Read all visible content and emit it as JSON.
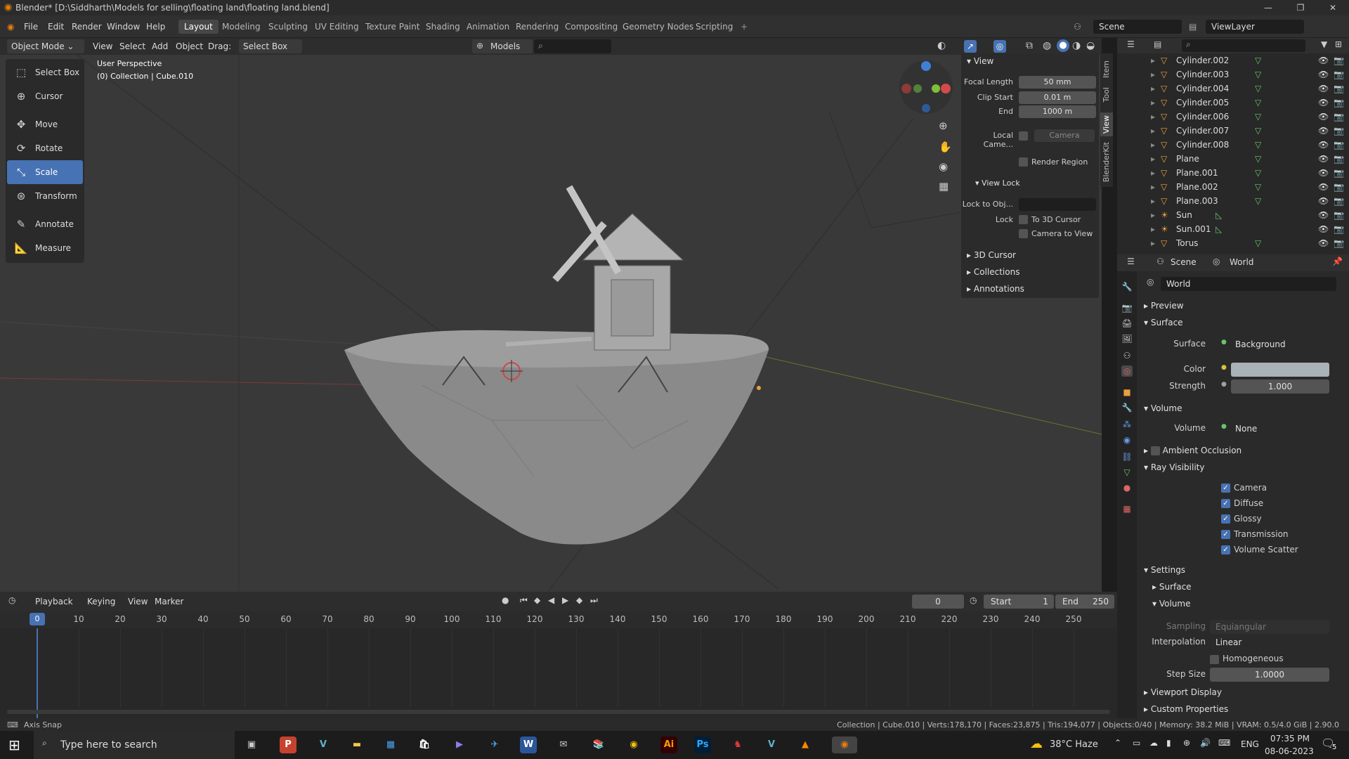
{
  "window": {
    "title": "Blender* [D:\\Siddharth\\Models for selling\\floating land\\floating land.blend]",
    "minimize": "—",
    "maximize": "❐",
    "close": "✕"
  },
  "menu": {
    "file": "File",
    "edit": "Edit",
    "render": "Render",
    "window": "Window",
    "help": "Help"
  },
  "workspaces": [
    "Layout",
    "Modeling",
    "Sculpting",
    "UV Editing",
    "Texture Paint",
    "Shading",
    "Animation",
    "Rendering",
    "Compositing",
    "Geometry Nodes",
    "Scripting"
  ],
  "active_workspace": "Layout",
  "scene_name": "Scene",
  "viewlayer_name": "ViewLayer",
  "viewport_header": {
    "mode": "Object Mode",
    "view": "View",
    "select": "Select",
    "add": "Add",
    "object": "Object",
    "drag_label": "Drag:",
    "drag_value": "Select Box",
    "models": "Models"
  },
  "viewport_info": {
    "line1": "User Perspective",
    "line2": "(0) Collection | Cube.010"
  },
  "tools": [
    "Select Box",
    "Cursor",
    "Move",
    "Rotate",
    "Scale",
    "Transform",
    "Annotate",
    "Measure"
  ],
  "active_tool": "Scale",
  "npanel": {
    "view_header": "View",
    "focal_length_label": "Focal Length",
    "focal_length": "50 mm",
    "clip_start_label": "Clip Start",
    "clip_start": "0.01 m",
    "end_label": "End",
    "end": "1000 m",
    "local_camera_label": "Local Came...",
    "local_camera": "Camera",
    "render_region": "Render Region",
    "view_lock_header": "View Lock",
    "lock_to_obj_label": "Lock to Obj...",
    "lock_label": "Lock",
    "to_3d_cursor": "To 3D Cursor",
    "camera_to_view": "Camera to View",
    "cursor_3d": "3D Cursor",
    "collections": "Collections",
    "annotations": "Annotations",
    "tabs": [
      "Item",
      "Tool",
      "View",
      "BlenderKit"
    ]
  },
  "outliner": [
    {
      "name": "Cylinder.002",
      "type": "mesh"
    },
    {
      "name": "Cylinder.003",
      "type": "mesh"
    },
    {
      "name": "Cylinder.004",
      "type": "mesh"
    },
    {
      "name": "Cylinder.005",
      "type": "mesh"
    },
    {
      "name": "Cylinder.006",
      "type": "mesh"
    },
    {
      "name": "Cylinder.007",
      "type": "mesh"
    },
    {
      "name": "Cylinder.008",
      "type": "mesh"
    },
    {
      "name": "Plane",
      "type": "mesh"
    },
    {
      "name": "Plane.001",
      "type": "mesh"
    },
    {
      "name": "Plane.002",
      "type": "mesh"
    },
    {
      "name": "Plane.003",
      "type": "mesh"
    },
    {
      "name": "Sun",
      "type": "light"
    },
    {
      "name": "Sun.001",
      "type": "light"
    },
    {
      "name": "Torus",
      "type": "mesh"
    }
  ],
  "properties": {
    "breadcrumb_scene": "Scene",
    "breadcrumb_world": "World",
    "world_name": "World",
    "preview": "Preview",
    "surface_header": "Surface",
    "surface_label": "Surface",
    "surface_value": "Background",
    "color_label": "Color",
    "color_value": "#a9b2b6",
    "strength_label": "Strength",
    "strength_value": "1.000",
    "volume_header": "Volume",
    "volume_label": "Volume",
    "volume_value": "None",
    "ambient_occlusion": "Ambient Occlusion",
    "ray_visibility": "Ray Visibility",
    "ray_items": [
      "Camera",
      "Diffuse",
      "Glossy",
      "Transmission",
      "Volume Scatter"
    ],
    "settings": "Settings",
    "settings_surface": "Surface",
    "settings_volume": "Volume",
    "sampling_label": "Sampling",
    "sampling_value": "Equiangular",
    "interpolation_label": "Interpolation",
    "interpolation_value": "Linear",
    "homogeneous": "Homogeneous",
    "step_size_label": "Step Size",
    "step_size_value": "1.0000",
    "viewport_display": "Viewport Display",
    "custom_properties": "Custom Properties"
  },
  "timeline": {
    "playback": "Playback",
    "keying": "Keying",
    "view": "View",
    "marker": "Marker",
    "current_frame": "0",
    "start_label": "Start",
    "start": "1",
    "end_label": "End",
    "end": "250",
    "ticks": [
      "0",
      "10",
      "20",
      "30",
      "40",
      "50",
      "60",
      "70",
      "80",
      "90",
      "100",
      "110",
      "120",
      "130",
      "140",
      "150",
      "160",
      "170",
      "180",
      "190",
      "200",
      "210",
      "220",
      "230",
      "240",
      "250"
    ]
  },
  "statusbar": {
    "left": "Axis Snap",
    "right": "Collection | Cube.010 | Verts:178,170 | Faces:23,875 | Tris:194,077 | Objects:0/40 | Memory: 38.2 MiB | VRAM: 0.5/4.0 GiB | 2.90.0"
  },
  "taskbar": {
    "search_placeholder": "Type here to search",
    "weather": "38°C  Haze",
    "language": "ENG",
    "time": "07:35 PM",
    "date": "08-06-2023",
    "notifications": "5"
  }
}
